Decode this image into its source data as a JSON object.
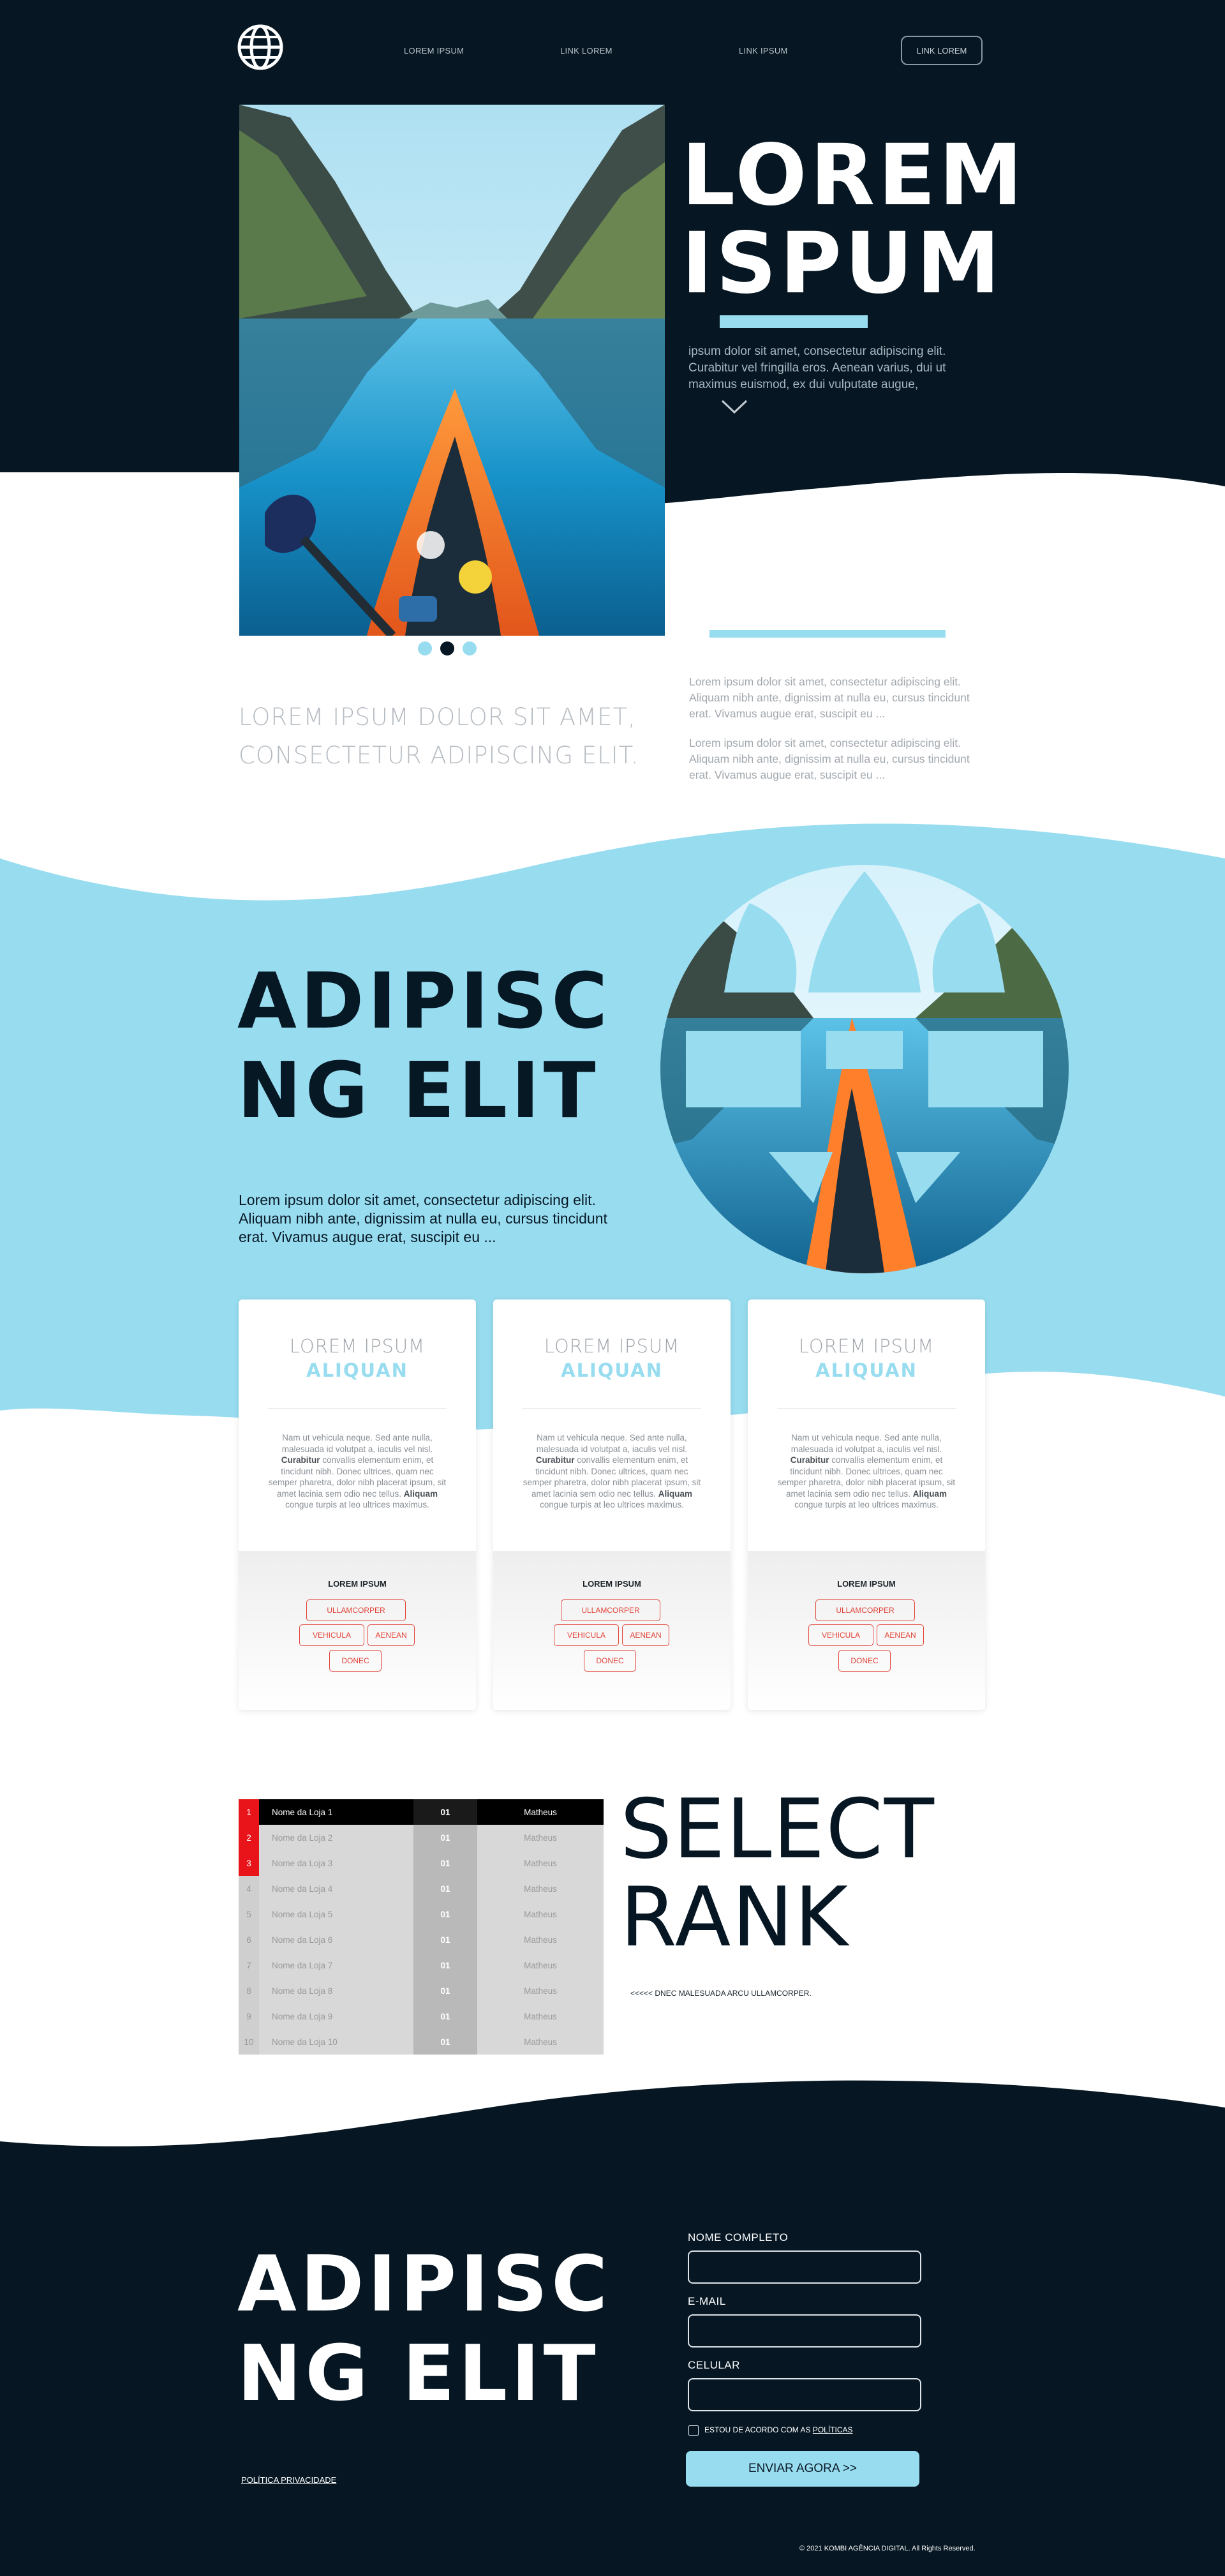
{
  "header": {
    "nav": [
      "LOREM IPSUM",
      "LINK LOREM",
      "LINK IPSUM"
    ],
    "cta": "LINK LOREM",
    "logo_icon": "globe-icon"
  },
  "hero": {
    "title_line1": "LOREM",
    "title_line2": "ISPUM",
    "text": "ipsum dolor sit amet, consectetur adipiscing elit. Curabitur vel fringilla eros. Aenean varius, dui ut maximus euismod, ex dui vulputate augue,",
    "scroll_icon": "chevron-down-icon",
    "carousel_active": 2,
    "carousel_total": 3
  },
  "intro": {
    "title_line1": "LOREM IPSUM DOLOR SIT AMET,",
    "title_line2": "CONSECTETUR ADIPISCING ELIT.",
    "para1": "Lorem ipsum dolor sit amet, consectetur adipiscing elit. Aliquam nibh ante, dignissim at nulla eu, cursus tincidunt erat. Vivamus augue erat, suscipit eu ...",
    "para2": "Lorem ipsum dolor sit amet, consectetur adipiscing elit. Aliquam nibh ante, dignissim at nulla eu, cursus tincidunt erat. Vivamus augue erat, suscipit eu ..."
  },
  "feature": {
    "title_line1": "ADIPISC",
    "title_line2": "NG ELIT",
    "text": "Lorem ipsum dolor sit amet, consectetur adipiscing elit. Aliquam nibh ante, dignissim at nulla eu, cursus tincidunt erat. Vivamus augue erat, suscipit eu ..."
  },
  "cards": [
    {
      "title1": "LOREM IPSUM",
      "title2": "ALIQUAN",
      "text_a": "Nam ut vehicula neque. Sed ante nulla, malesuada id volutpat a, iaculis vel nisl. ",
      "text_b": "Curabitur",
      "text_c": " convallis elementum enim, et tincidunt nibh. Donec ultrices, quam nec semper pharetra, dolor nibh placerat ipsum, sit amet lacinia sem odio nec tellus. ",
      "text_d": "Aliquam",
      "text_e": " congue turpis at leo ultrices maximus.",
      "sub": "LOREM IPSUM",
      "tags": [
        "ULLAMCORPER",
        "VEHICULA",
        "AENEAN",
        "DONEC"
      ]
    },
    {
      "title1": "LOREM IPSUM",
      "title2": "ALIQUAN",
      "text_a": "Nam ut vehicula neque. Sed ante nulla, malesuada id volutpat a, iaculis vel nisl. ",
      "text_b": "Curabitur",
      "text_c": " convallis elementum enim, et tincidunt nibh. Donec ultrices, quam nec semper pharetra, dolor nibh placerat ipsum, sit amet lacinia sem odio nec tellus. ",
      "text_d": "Aliquam",
      "text_e": " congue turpis at leo ultrices maximus.",
      "sub": "LOREM IPSUM",
      "tags": [
        "ULLAMCORPER",
        "VEHICULA",
        "AENEAN",
        "DONEC"
      ]
    },
    {
      "title1": "LOREM IPSUM",
      "title2": "ALIQUAN",
      "text_a": "Nam ut vehicula neque. Sed ante nulla, malesuada id volutpat a, iaculis vel nisl. ",
      "text_b": "Curabitur",
      "text_c": " convallis elementum enim, et tincidunt nibh. Donec ultrices, quam nec semper pharetra, dolor nibh placerat ipsum, sit amet lacinia sem odio nec tellus. ",
      "text_d": "Aliquam",
      "text_e": " congue turpis at leo ultrices maximus.",
      "sub": "LOREM IPSUM",
      "tags": [
        "ULLAMCORPER",
        "VEHICULA",
        "AENEAN",
        "DONEC"
      ]
    }
  ],
  "rank": {
    "rows": [
      {
        "pos": "1",
        "name": "Nome da Loja 1",
        "score": "01",
        "owner": "Matheus"
      },
      {
        "pos": "2",
        "name": "Nome da Loja 2",
        "score": "01",
        "owner": "Matheus"
      },
      {
        "pos": "3",
        "name": "Nome da Loja 3",
        "score": "01",
        "owner": "Matheus"
      },
      {
        "pos": "4",
        "name": "Nome da Loja 4",
        "score": "01",
        "owner": "Matheus"
      },
      {
        "pos": "5",
        "name": "Nome da Loja 5",
        "score": "01",
        "owner": "Matheus"
      },
      {
        "pos": "6",
        "name": "Nome da Loja 6",
        "score": "01",
        "owner": "Matheus"
      },
      {
        "pos": "7",
        "name": "Nome da Loja 7",
        "score": "01",
        "owner": "Matheus"
      },
      {
        "pos": "8",
        "name": "Nome da Loja 8",
        "score": "01",
        "owner": "Matheus"
      },
      {
        "pos": "9",
        "name": "Nome da Loja 9",
        "score": "01",
        "owner": "Matheus"
      },
      {
        "pos": "10",
        "name": "Nome da Loja 10",
        "score": "01",
        "owner": "Matheus"
      }
    ],
    "title_line1": "SELECT",
    "title_line2": "RANK",
    "caption": "<<<<< DNEC MALESUADA ARCU ULLAMCORPER."
  },
  "contact": {
    "title_line1": "ADIPISC",
    "title_line2": "NG ELIT",
    "privacy_link": "POLÍTICA PRIVACIDADE",
    "fields": [
      "NOME COMPLETO",
      "E-MAIL",
      "CELULAR"
    ],
    "consent_prefix": "ESTOU DE ACORDO COM AS ",
    "consent_link": "POLÍTICAS",
    "submit": "ENVIAR AGORA >>",
    "copyright": "© 2021 KOMBI AGÊNCIA DIGITAL. All Rights Reserved."
  },
  "colors": {
    "navy": "#061723",
    "sky": "#98dcf0",
    "accent_red": "#e2453a",
    "rank_red": "#e8141a"
  }
}
